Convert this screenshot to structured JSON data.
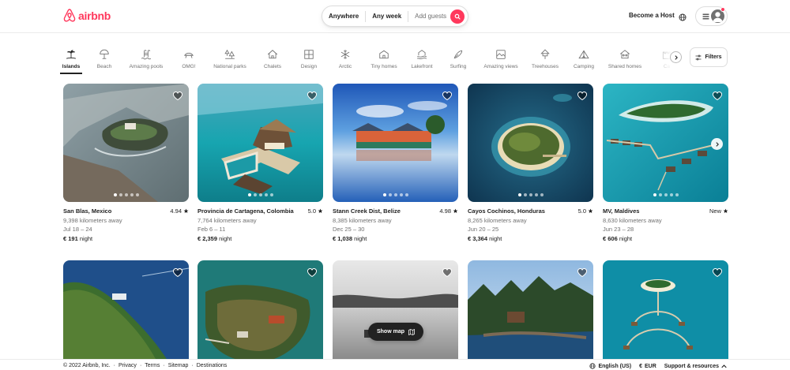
{
  "brand": {
    "name": "airbnb",
    "color": "#ff385c"
  },
  "search": {
    "anywhere": "Anywhere",
    "any_week": "Any week",
    "add_guests": "Add guests"
  },
  "header": {
    "become_host": "Become a Host"
  },
  "categories": [
    {
      "label": "Islands",
      "icon": "island-icon",
      "active": true
    },
    {
      "label": "Beach",
      "icon": "umbrella-icon"
    },
    {
      "label": "Amazing pools",
      "icon": "pool-icon"
    },
    {
      "label": "OMG!",
      "icon": "ufo-house-icon"
    },
    {
      "label": "National parks",
      "icon": "park-icon"
    },
    {
      "label": "Chalets",
      "icon": "chalet-icon"
    },
    {
      "label": "Design",
      "icon": "design-icon"
    },
    {
      "label": "Arctic",
      "icon": "snowflake-icon"
    },
    {
      "label": "Tiny homes",
      "icon": "tiny-home-icon"
    },
    {
      "label": "Lakefront",
      "icon": "lakefront-icon"
    },
    {
      "label": "Surfing",
      "icon": "surfboard-icon"
    },
    {
      "label": "Amazing views",
      "icon": "view-icon"
    },
    {
      "label": "Treehouses",
      "icon": "treehouse-icon"
    },
    {
      "label": "Camping",
      "icon": "tent-icon"
    },
    {
      "label": "Shared homes",
      "icon": "shared-home-icon"
    },
    {
      "label": "Ca",
      "icon": "castle-icon"
    }
  ],
  "filters_label": "Filters",
  "listings": [
    {
      "title": "San Blas, Mexico",
      "rating": "4.94",
      "distance": "9,398 kilometers away",
      "dates": "Jul 18 – 24",
      "price": "€ 191",
      "unit": "night"
    },
    {
      "title": "Provincia de Cartagena, Colombia",
      "rating": "5.0",
      "distance": "7,764 kilometers away",
      "dates": "Feb 6 – 11",
      "price": "€ 2,359",
      "unit": "night"
    },
    {
      "title": "Stann Creek Dist, Belize",
      "rating": "4.98",
      "distance": "8,385 kilometers away",
      "dates": "Dec 25 – 30",
      "price": "€ 1,038",
      "unit": "night"
    },
    {
      "title": "Cayos Cochinos, Honduras",
      "rating": "5.0",
      "distance": "8,265 kilometers away",
      "dates": "Jun 20 – 25",
      "price": "€ 3,364",
      "unit": "night"
    },
    {
      "title": "MV, Maldives",
      "rating": "New",
      "distance": "8,630 kilometers away",
      "dates": "Jun 23 – 28",
      "price": "€ 606",
      "unit": "night"
    }
  ],
  "show_map": "Show map",
  "footer": {
    "copyright": "© 2022 Airbnb, Inc.",
    "links": [
      "Privacy",
      "Terms",
      "Sitemap",
      "Destinations"
    ],
    "language": "English (US)",
    "currency": "EUR",
    "support": "Support & resources"
  }
}
